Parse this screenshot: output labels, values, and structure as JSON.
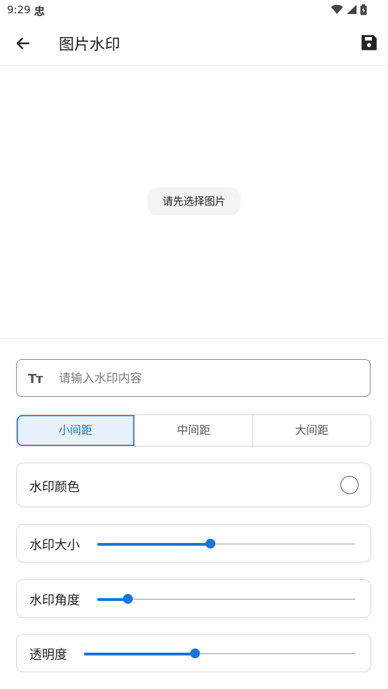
{
  "status": {
    "time": "9:29",
    "app_icon_text": "忠"
  },
  "appbar": {
    "title": "图片水印"
  },
  "preview": {
    "hint": "请先选择图片"
  },
  "watermark_input": {
    "placeholder": "请输入水印内容",
    "value": ""
  },
  "spacing": {
    "options": [
      "小间距",
      "中间距",
      "大间距"
    ],
    "selected_index": 0
  },
  "color_card": {
    "label": "水印颜色",
    "color": "#ffffff"
  },
  "size_card": {
    "label": "水印大小",
    "value": 0.44
  },
  "angle_card": {
    "label": "水印角度",
    "value": 0.12
  },
  "opacity_card": {
    "label": "透明度",
    "value": 0.41
  },
  "colors": {
    "accent": "#1a73d9"
  }
}
